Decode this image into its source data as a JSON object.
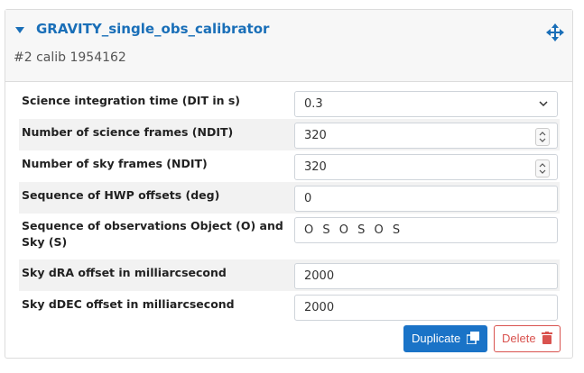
{
  "panel": {
    "title": "GRAVITY_single_obs_calibrator",
    "subtitle": "#2 calib 1954162",
    "icons": {
      "collapse": "caret-down-icon",
      "move": "move-arrows-icon"
    }
  },
  "fields": [
    {
      "label": "Science integration time (DIT in s)",
      "value": "0.3",
      "control": "select"
    },
    {
      "label": "Number of science frames (NDIT)",
      "value": "320",
      "control": "number"
    },
    {
      "label": "Number of sky frames (NDIT)",
      "value": "320",
      "control": "number"
    },
    {
      "label": "Sequence of HWP offsets (deg)",
      "value": "0",
      "control": "text"
    },
    {
      "label": "Sequence of observations Object (O) and Sky (S)",
      "value": "O S O S O S",
      "control": "text"
    },
    {
      "label": "Sky dRA offset in milliarcsecond",
      "value": "2000",
      "control": "text"
    },
    {
      "label": "Sky dDEC offset in milliarcsecond",
      "value": "2000",
      "control": "text"
    }
  ],
  "actions": {
    "duplicate_label": "Duplicate",
    "delete_label": "Delete",
    "colors": {
      "primary": "#1a73c7",
      "danger": "#d9534f",
      "title": "#1a6fb8"
    }
  }
}
